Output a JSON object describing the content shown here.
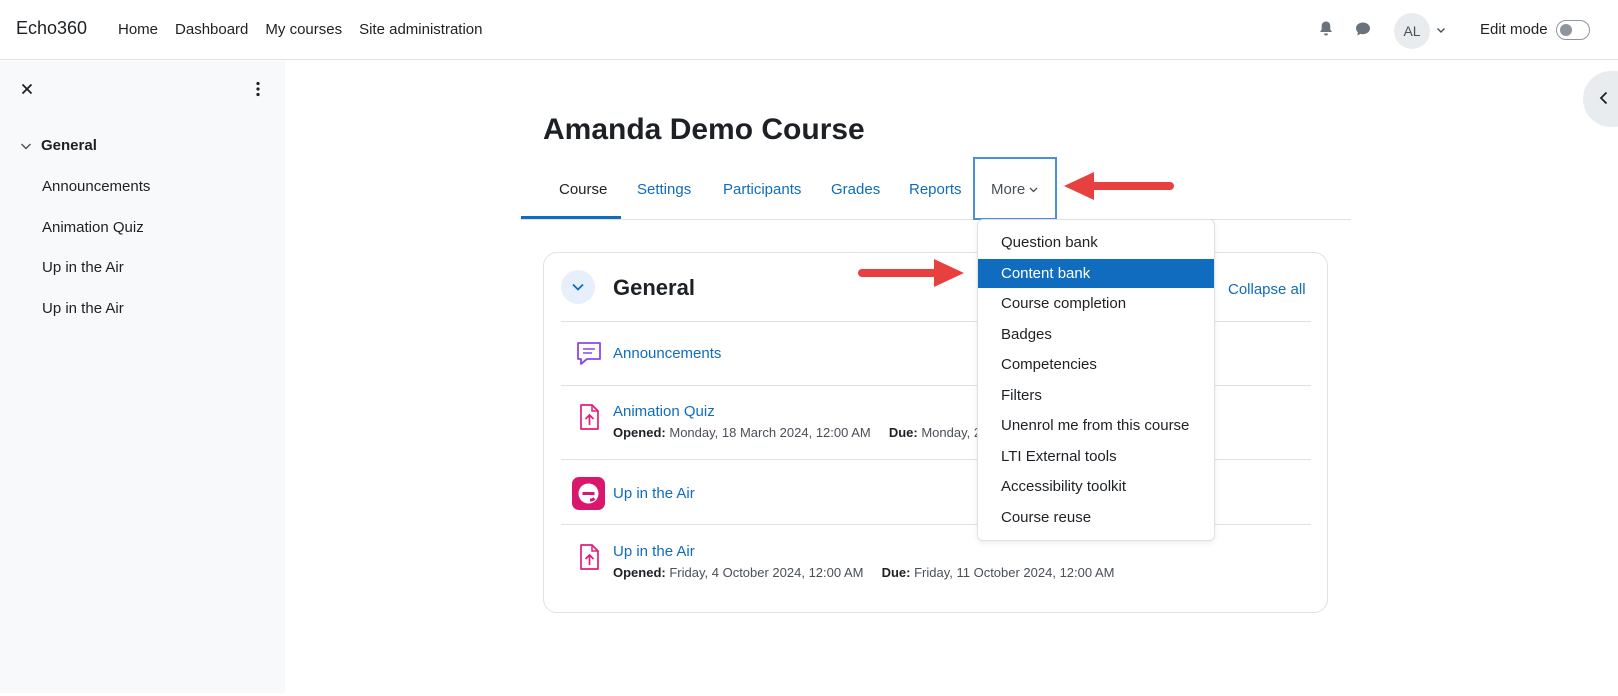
{
  "navbar": {
    "brand": "Echo360",
    "links": [
      "Home",
      "Dashboard",
      "My courses",
      "Site administration"
    ],
    "avatar_initials": "AL",
    "edit_mode_label": "Edit mode",
    "edit_mode_on": false
  },
  "drawer": {
    "section_label": "General",
    "items": [
      "Announcements",
      "Animation Quiz",
      "Up in the Air",
      "Up in the Air"
    ]
  },
  "course": {
    "title": "Amanda Demo Course",
    "tabs": [
      "Course",
      "Settings",
      "Participants",
      "Grades",
      "Reports"
    ],
    "active_tab": "Course",
    "more_label": "More"
  },
  "section": {
    "title": "General",
    "collapse_all": "Collapse all",
    "activities": [
      {
        "name": "Announcements",
        "type": "forum"
      },
      {
        "name": "Animation Quiz",
        "type": "assignment",
        "opened_label": "Opened:",
        "opened": "Monday, 18 March 2024, 12:00 AM",
        "due_label": "Due:",
        "due": "Monday, 2"
      },
      {
        "name": "Up in the Air",
        "type": "echo360"
      },
      {
        "name": "Up in the Air",
        "type": "assignment",
        "opened_label": "Opened:",
        "opened": "Friday, 4 October 2024, 12:00 AM",
        "due_label": "Due:",
        "due": "Friday, 11 October 2024, 12:00 AM"
      }
    ]
  },
  "more_menu": {
    "items": [
      "Question bank",
      "Content bank",
      "Course completion",
      "Badges",
      "Competencies",
      "Filters",
      "Unenrol me from this course",
      "LTI External tools",
      "Accessibility toolkit",
      "Course reuse"
    ],
    "highlighted": "Content bank"
  },
  "colors": {
    "link": "#0f6cbf",
    "highlight": "#0f6cbf",
    "annotation_arrow": "#e8403f",
    "echo_brand": "#d9176c",
    "forum_icon": "#8c47e6",
    "assign_icon": "#e01e7a"
  }
}
